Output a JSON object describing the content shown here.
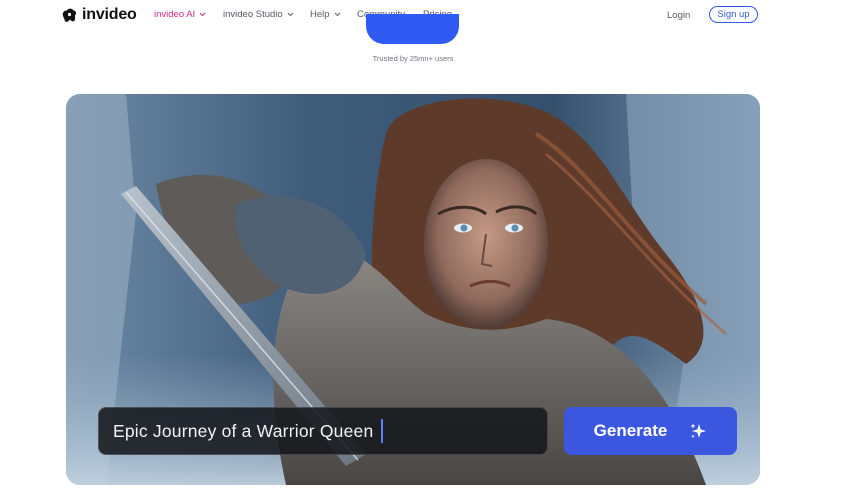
{
  "brand": {
    "name": "invideo"
  },
  "nav": {
    "items": [
      {
        "label": "invideo AI",
        "dropdown": true,
        "active": true
      },
      {
        "label": "invideo Studio",
        "dropdown": true
      },
      {
        "label": "Help",
        "dropdown": true
      },
      {
        "label": "Community",
        "dropdown": false
      },
      {
        "label": "Pricing",
        "dropdown": false
      }
    ],
    "login": "Login",
    "signup": "Sign up"
  },
  "hero": {
    "trusted_text": "Trusted by 25mn+ users",
    "prompt_value": "Epic Journey of a Warrior Queen",
    "generate_label": "Generate"
  },
  "colors": {
    "accent_pink": "#d02a86",
    "primary_blue": "#2f5bd6",
    "generate_blue": "#3b57e0"
  },
  "icons": [
    "invideo-logo-icon",
    "chevron-down-icon",
    "sparkle-icon"
  ]
}
